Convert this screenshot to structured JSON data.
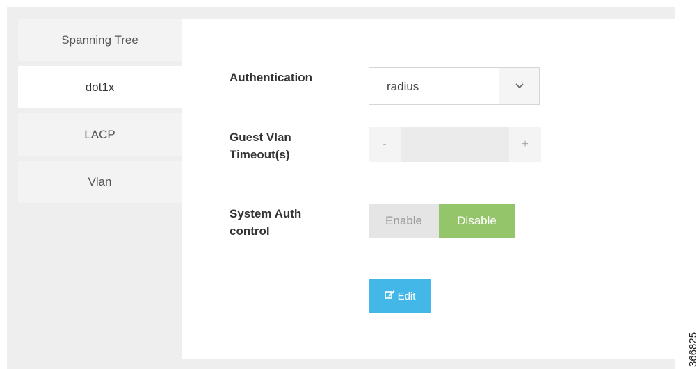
{
  "sidebar": {
    "items": [
      {
        "label": "Spanning Tree"
      },
      {
        "label": "dot1x"
      },
      {
        "label": "LACP"
      },
      {
        "label": "Vlan"
      }
    ]
  },
  "form": {
    "authentication": {
      "label": "Authentication",
      "value": "radius"
    },
    "guest_vlan": {
      "label_line1": "Guest Vlan",
      "label_line2": "Timeout(s)",
      "minus": "-",
      "plus": "+",
      "value": ""
    },
    "system_auth": {
      "label_line1": "System Auth",
      "label_line2": "control",
      "enable": "Enable",
      "disable": "Disable",
      "selected": "Disable"
    },
    "edit_label": "Edit"
  },
  "figure_id": "366825",
  "colors": {
    "accent_green": "#95c56a",
    "accent_blue": "#43b8e8"
  }
}
